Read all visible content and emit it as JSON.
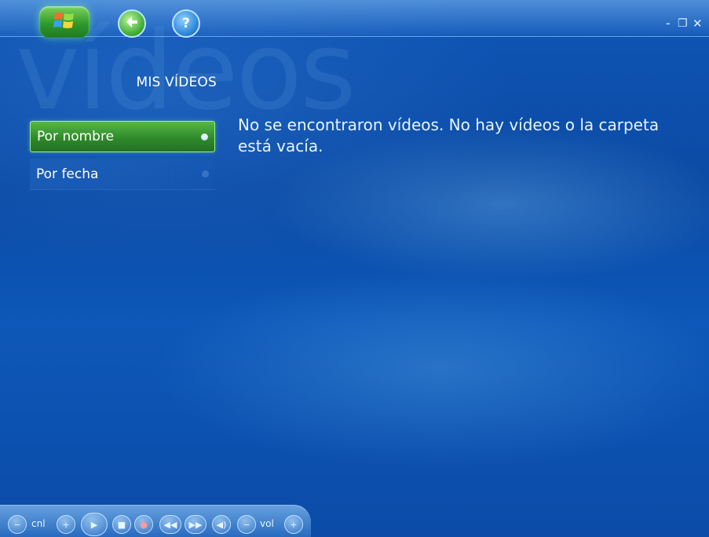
{
  "watermark": "vídeos",
  "page": {
    "title": "MIS VÍDEOS"
  },
  "menu": {
    "items": [
      {
        "label": "Por nombre",
        "selected": true
      },
      {
        "label": "Por fecha",
        "selected": false
      }
    ]
  },
  "message": "No se encontraron vídeos. No hay vídeos o la carpeta está vacía.",
  "window_controls": {
    "minimize": "-",
    "restore": "❐",
    "close": "✕"
  },
  "transport": {
    "channel_label": "cnl",
    "volume_label": "vol",
    "icons": [
      "channel-down-icon",
      "channel-up-icon",
      "play-icon",
      "stop-icon",
      "record-icon",
      "rewind-icon",
      "fast-forward-icon",
      "mute-icon",
      "volume-down-icon",
      "volume-up-icon"
    ]
  },
  "colors": {
    "accent_green": "#2f8a2a",
    "background_blue": "#0b4aa4",
    "text": "#ffffff"
  }
}
